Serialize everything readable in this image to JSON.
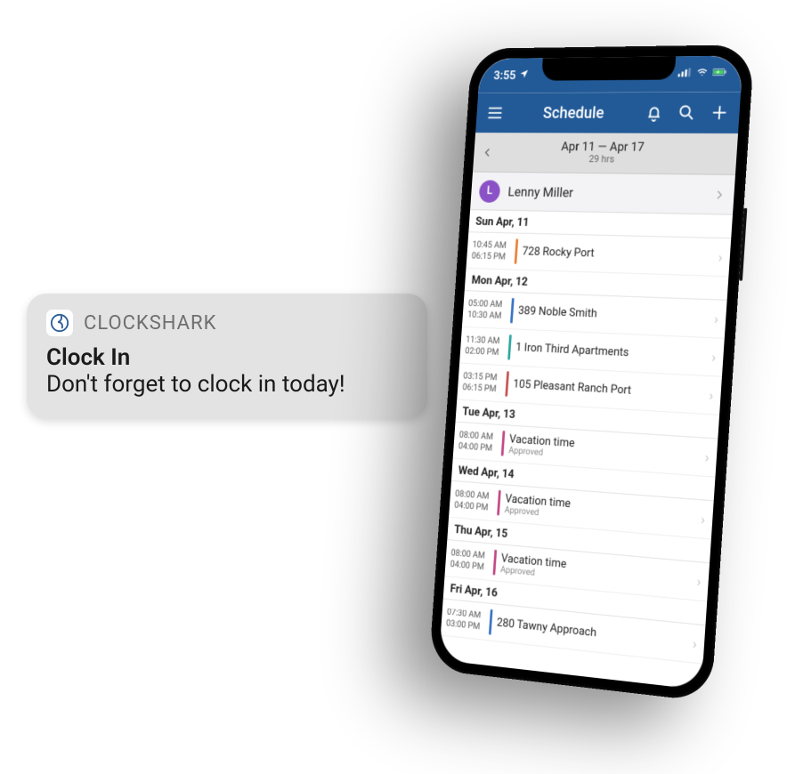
{
  "notification": {
    "app": "CLOCKSHARK",
    "title": "Clock In",
    "body": "Don't forget to clock in today!"
  },
  "statusbar": {
    "time": "3:55",
    "location_icon": "location-icon"
  },
  "navbar": {
    "title": "Schedule",
    "menu_icon": "menu-icon",
    "bell_icon": "bell-icon",
    "search_icon": "search-icon",
    "add_icon": "plus-icon"
  },
  "datestrip": {
    "range": "Apr 11 — Apr 17",
    "hours": "29 hrs"
  },
  "user": {
    "initial": "L",
    "name": "Lenny Miller"
  },
  "colors": {
    "orange": "#e8833a",
    "blue": "#3a74c4",
    "teal": "#2fa7a0",
    "red": "#c75454",
    "pink": "#c24a86"
  },
  "schedule": [
    {
      "day": "Sun Apr, 11",
      "entries": [
        {
          "start": "10:45 AM",
          "end": "06:15 PM",
          "title": "728 Rocky Port",
          "sub": "",
          "color": "orange"
        }
      ]
    },
    {
      "day": "Mon Apr, 12",
      "entries": [
        {
          "start": "05:00 AM",
          "end": "10:30 AM",
          "title": "389 Noble Smith",
          "sub": "",
          "color": "blue"
        },
        {
          "start": "11:30 AM",
          "end": "02:00 PM",
          "title": "1 Iron Third Apartments",
          "sub": "",
          "color": "teal"
        },
        {
          "start": "03:15 PM",
          "end": "06:15 PM",
          "title": "105 Pleasant Ranch Port",
          "sub": "",
          "color": "red"
        }
      ]
    },
    {
      "day": "Tue Apr, 13",
      "entries": [
        {
          "start": "08:00 AM",
          "end": "04:00 PM",
          "title": "Vacation time",
          "sub": "Approved",
          "color": "pink"
        }
      ]
    },
    {
      "day": "Wed Apr, 14",
      "entries": [
        {
          "start": "08:00 AM",
          "end": "04:00 PM",
          "title": "Vacation time",
          "sub": "Approved",
          "color": "pink"
        }
      ]
    },
    {
      "day": "Thu Apr, 15",
      "entries": [
        {
          "start": "08:00 AM",
          "end": "04:00 PM",
          "title": "Vacation time",
          "sub": "Approved",
          "color": "pink"
        }
      ]
    },
    {
      "day": "Fri Apr, 16",
      "entries": [
        {
          "start": "07:30 AM",
          "end": "03:00 PM",
          "title": "280 Tawny Approach",
          "sub": "",
          "color": "blue"
        }
      ]
    }
  ]
}
